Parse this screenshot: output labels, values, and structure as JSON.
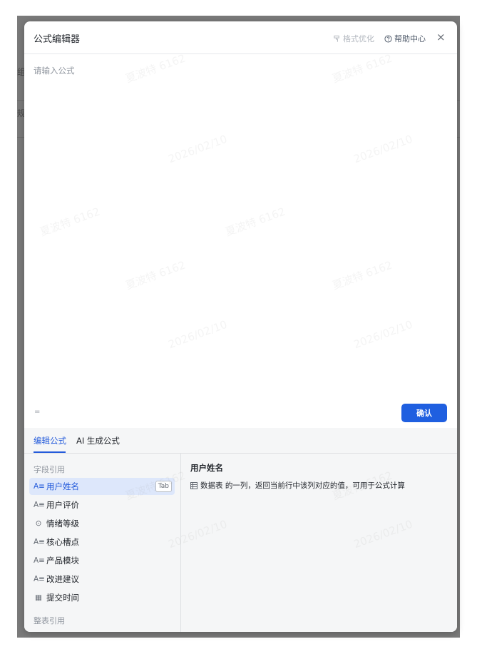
{
  "dialog": {
    "title": "公式编辑器",
    "format_label": "格式优化",
    "help_label": "帮助中心",
    "close_glyph": "×"
  },
  "editor": {
    "placeholder": "请输入公式",
    "equals": "=",
    "confirm_label": "确认"
  },
  "tabs": [
    {
      "label": "编辑公式",
      "active": true
    },
    {
      "label": "AI 生成公式",
      "active": false
    }
  ],
  "field_reference": {
    "section_label": "字段引用",
    "items": [
      {
        "label": "用户姓名",
        "icon": "text-field-icon",
        "glyph": "A≡",
        "selected": true,
        "shortcut": "Tab"
      },
      {
        "label": "用户评价",
        "icon": "text-field-icon",
        "glyph": "A≡",
        "selected": false
      },
      {
        "label": "情绪等级",
        "icon": "single-select-icon",
        "glyph": "⊙",
        "selected": false
      },
      {
        "label": "核心槽点",
        "icon": "text-field-icon",
        "glyph": "A≡",
        "selected": false
      },
      {
        "label": "产品模块",
        "icon": "text-field-icon",
        "glyph": "A≡",
        "selected": false
      },
      {
        "label": "改进建议",
        "icon": "text-field-icon",
        "glyph": "A≡",
        "selected": false
      },
      {
        "label": "提交时间",
        "icon": "date-field-icon",
        "glyph": "▦",
        "selected": false
      }
    ],
    "table_section_label": "整表引用"
  },
  "detail": {
    "title": "用户姓名",
    "description": "数据表 的一列，返回当前行中该列对应的值，可用于公式计算"
  },
  "background": {
    "fragment_1": "组",
    "fragment_2": "规"
  },
  "watermark": {
    "name": "夏波特 6162",
    "date": "2026/02/10"
  },
  "colors": {
    "accent": "#245bdb",
    "confirm_button": "#1f5fe0",
    "overlay": "#7a7a7a"
  }
}
